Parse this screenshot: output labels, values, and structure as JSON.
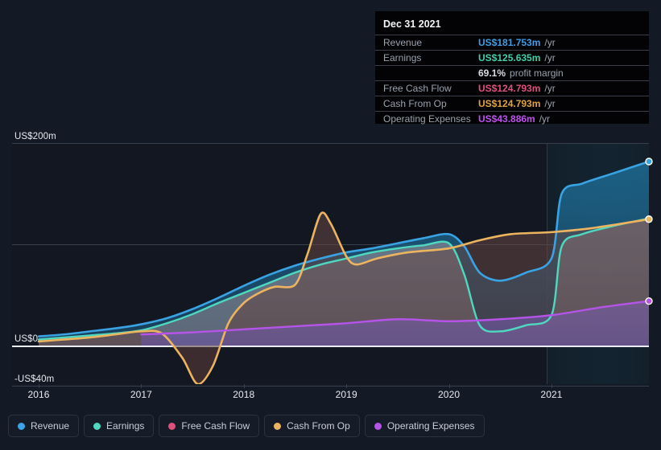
{
  "chart_data": {
    "type": "area",
    "title": "",
    "xlabel": "",
    "ylabel": "",
    "currency": "US$",
    "ylim": [
      -40,
      200
    ],
    "yticks": [
      {
        "value": 200,
        "label": "US$200m"
      },
      {
        "value": 100,
        "label": ""
      },
      {
        "value": 0,
        "label": "US$0"
      },
      {
        "value": -40,
        "label": "-US$40m"
      }
    ],
    "grid": true,
    "legend_position": "bottom",
    "xticks": [
      "2016",
      "2017",
      "2018",
      "2019",
      "2020",
      "2021"
    ],
    "x_range": [
      2016,
      2021.95
    ],
    "forecast_divider_x": 2021,
    "series": [
      {
        "name": "Revenue",
        "color": "#3aa3e3",
        "x": [
          2016.0,
          2016.25,
          2016.5,
          2016.75,
          2017.0,
          2017.25,
          2017.5,
          2017.75,
          2018.0,
          2018.25,
          2018.5,
          2018.75,
          2019.0,
          2019.25,
          2019.5,
          2019.75,
          2020.0,
          2020.15,
          2020.3,
          2020.5,
          2020.75,
          2021.0,
          2021.1,
          2021.3,
          2021.6,
          2021.95
        ],
        "values": [
          9,
          11,
          14,
          17,
          21,
          27,
          36,
          47,
          59,
          70,
          79,
          86,
          92,
          96,
          101,
          106,
          110,
          98,
          72,
          64,
          72,
          86,
          150,
          160,
          170,
          181.753
        ]
      },
      {
        "name": "Earnings",
        "color": "#4fd8c0",
        "x": [
          2016.0,
          2016.25,
          2016.5,
          2016.75,
          2017.0,
          2017.25,
          2017.5,
          2017.75,
          2018.0,
          2018.25,
          2018.5,
          2018.75,
          2019.0,
          2019.25,
          2019.5,
          2019.75,
          2020.0,
          2020.15,
          2020.3,
          2020.5,
          2020.75,
          2021.0,
          2021.1,
          2021.3,
          2021.6,
          2021.95
        ],
        "values": [
          6,
          8,
          10,
          12,
          15,
          22,
          31,
          42,
          52,
          62,
          72,
          80,
          86,
          92,
          96,
          99,
          101,
          70,
          20,
          14,
          20,
          30,
          98,
          110,
          118,
          125.635
        ]
      },
      {
        "name": "Free Cash Flow",
        "color": "#e0507f",
        "x": [
          2016.0,
          2017.0,
          2017.5,
          2017.75,
          2018.0,
          2018.5,
          2018.75,
          2019.0,
          2019.5,
          2020.0,
          2020.5,
          2021.0,
          2021.95
        ],
        "values": [
          4,
          14,
          -20,
          -38,
          35,
          72,
          130,
          78,
          88,
          92,
          100,
          110,
          124.793
        ]
      },
      {
        "name": "Cash From Op",
        "color": "#ecb45f",
        "x": [
          2016.0,
          2016.25,
          2016.5,
          2016.75,
          2017.0,
          2017.2,
          2017.4,
          2017.55,
          2017.7,
          2017.85,
          2018.0,
          2018.15,
          2018.3,
          2018.5,
          2018.62,
          2018.75,
          2018.85,
          2019.0,
          2019.1,
          2019.3,
          2019.6,
          2020.0,
          2020.3,
          2020.6,
          2021.0,
          2021.4,
          2021.95
        ],
        "values": [
          4,
          6,
          8,
          11,
          14,
          12,
          -12,
          -38,
          -20,
          22,
          42,
          52,
          58,
          60,
          90,
          130,
          120,
          88,
          80,
          86,
          92,
          96,
          104,
          110,
          112,
          116,
          124.793
        ]
      },
      {
        "name": "Operating Expenses",
        "color": "#b653e8",
        "x": [
          2017.0,
          2017.5,
          2018.0,
          2018.5,
          2019.0,
          2019.5,
          2020.0,
          2020.5,
          2021.0,
          2021.5,
          2021.95
        ],
        "values": [
          11,
          13,
          16,
          19,
          22,
          26,
          24,
          26,
          30,
          38,
          43.886
        ]
      }
    ],
    "endpoints": [
      {
        "series": "Revenue",
        "value": 181.753
      },
      {
        "series": "Cash From Op",
        "value": 124.793
      },
      {
        "series": "Operating Expenses",
        "value": 43.886
      }
    ]
  },
  "tooltip": {
    "date": "Dec 31 2021",
    "rows": [
      {
        "label": "Revenue",
        "value": "US$181.753m",
        "unit": "/yr",
        "color": "#3f9ee8"
      },
      {
        "label": "Earnings",
        "value": "US$125.635m",
        "unit": "/yr",
        "color": "#3fd0a8"
      },
      {
        "label": "",
        "value": "69.1%",
        "unit": "",
        "sub": "profit margin",
        "color": "#e6eaf0"
      },
      {
        "label": "Free Cash Flow",
        "value": "US$124.793m",
        "unit": "/yr",
        "color": "#e0507f"
      },
      {
        "label": "Cash From Op",
        "value": "US$124.793m",
        "unit": "/yr",
        "color": "#e0a33f"
      },
      {
        "label": "Operating Expenses",
        "value": "US$43.886m",
        "unit": "/yr",
        "color": "#c050f0"
      }
    ]
  },
  "legend": {
    "items": [
      {
        "label": "Revenue",
        "color": "#3aa3e3"
      },
      {
        "label": "Earnings",
        "color": "#4fd8c0"
      },
      {
        "label": "Free Cash Flow",
        "color": "#e0507f"
      },
      {
        "label": "Cash From Op",
        "color": "#ecb45f"
      },
      {
        "label": "Operating Expenses",
        "color": "#b653e8"
      }
    ]
  }
}
